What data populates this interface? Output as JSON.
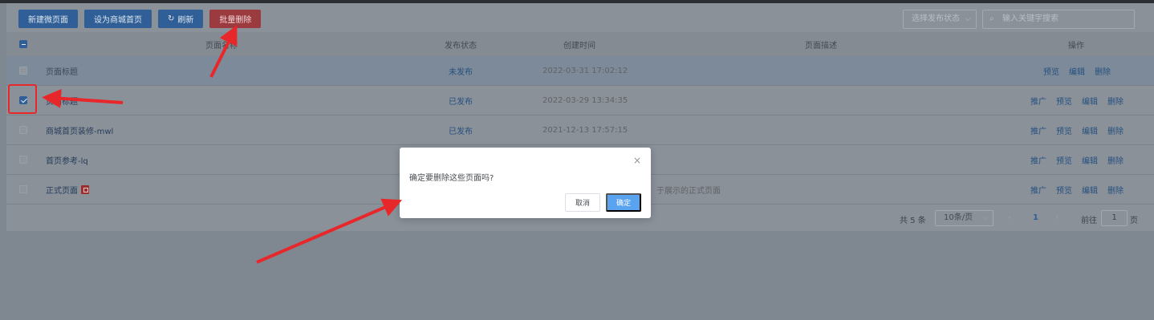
{
  "toolbar": {
    "new_page": "新建微页面",
    "set_home": "设为商城首页",
    "refresh": "刷新",
    "batch_delete": "批量删除"
  },
  "filters": {
    "status_placeholder": "选择发布状态",
    "search_placeholder": "输入关键字搜索"
  },
  "table": {
    "headers": {
      "name": "页面名称",
      "status": "发布状态",
      "created": "创建时间",
      "desc": "页面描述",
      "ops": "操作"
    },
    "rows": [
      {
        "name": "页面标题",
        "status": "未发布",
        "created": "2022-03-31 17:02:12",
        "desc": "",
        "ops": [
          "预览",
          "编辑",
          "删除"
        ]
      },
      {
        "name": "页面标题",
        "status": "已发布",
        "created": "2022-03-29 13:34:35",
        "desc": "",
        "ops": [
          "推广",
          "预览",
          "编辑",
          "删除"
        ]
      },
      {
        "name": "商城首页装修-mwl",
        "status": "已发布",
        "created": "2021-12-13 17:57:15",
        "desc": "",
        "ops": [
          "推广",
          "预览",
          "编辑",
          "删除"
        ]
      },
      {
        "name": "首页参考-lq",
        "status": "",
        "created": "",
        "desc": "",
        "ops": [
          "推广",
          "预览",
          "编辑",
          "删除"
        ]
      },
      {
        "name": "正式页面",
        "status": "",
        "created": "",
        "desc": "于展示的正式页面",
        "ops": [
          "推广",
          "预览",
          "编辑",
          "删除"
        ]
      }
    ]
  },
  "pagination": {
    "total": "共 5 条",
    "page_size": "10条/页",
    "prev": "‹",
    "current": "1",
    "next": "›",
    "goto_label": "前往",
    "goto_value": "1",
    "goto_unit": "页"
  },
  "dialog": {
    "message": "确定要删除这些页面吗?",
    "close": "×",
    "cancel": "取消",
    "confirm": "确定"
  },
  "colors": {
    "annotation_red": "#e8272a",
    "primary": "#409eff"
  }
}
